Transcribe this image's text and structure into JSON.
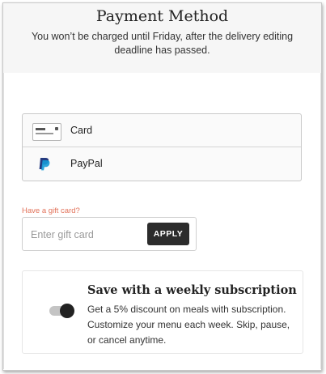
{
  "header": {
    "title": "Payment Method",
    "subtitle": "You won’t be charged until Friday, after the delivery editing deadline has passed."
  },
  "payment_methods": [
    {
      "label": "Card",
      "icon": "credit-card-icon"
    },
    {
      "label": "PayPal",
      "icon": "paypal-icon"
    }
  ],
  "gift_card": {
    "link_label": "Have a gift card?",
    "placeholder": "Enter gift card",
    "value": "",
    "apply_label": "APPLY"
  },
  "subscription": {
    "title": "Save with a weekly subscription",
    "description": "Get a 5% discount on meals with subscription. Customize your menu each week. Skip, pause, or cancel anytime.",
    "toggle_on": true
  },
  "colors": {
    "accent_link": "#e2735b",
    "button_dark": "#2c2c2c",
    "paypal_dark": "#253b80",
    "paypal_light": "#179bd7"
  }
}
